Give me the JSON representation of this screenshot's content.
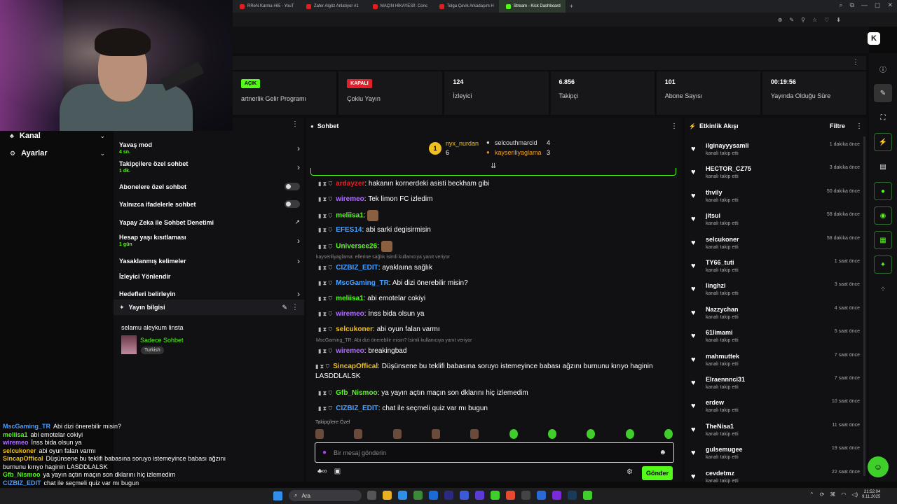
{
  "tabs": [
    {
      "label": "RReN Karma #65 - YouT",
      "active": false
    },
    {
      "label": "Zafer Algöz Anlatıyor #1",
      "active": false
    },
    {
      "label": "MAÇIN HİKAYESİ!: Conc",
      "active": false
    },
    {
      "label": "Tolga Çevik Arkadaşım H",
      "active": false
    },
    {
      "label": "Stream - Kick Dashboard",
      "active": true
    }
  ],
  "new_tab": "+",
  "stats": [
    {
      "badge": "AÇIK",
      "label": "artnerlik Gelir Programı",
      "badge_color": "green"
    },
    {
      "badge": "KAPALI",
      "label": "Çoklu Yayın",
      "badge_color": "red"
    },
    {
      "value": "124",
      "label": "İzleyici"
    },
    {
      "value": "6.856",
      "label": "Takipçi"
    },
    {
      "value": "101",
      "label": "Abone Sayısı"
    },
    {
      "value": "00:19:56",
      "label": "Yayında Olduğu Süre"
    }
  ],
  "leftnav": {
    "channel": "Kanal",
    "settings": "Ayarlar"
  },
  "chat_settings": [
    {
      "title": "Yavaş mod",
      "sub": "4 sn.",
      "control": "chevron"
    },
    {
      "title": "Takipçilere özel sohbet",
      "sub": "1 dk.",
      "control": "chevron"
    },
    {
      "title": "Abonelere özel sohbet",
      "sub": "",
      "control": "toggle"
    },
    {
      "title": "Yalnızca ifadelerle sohbet",
      "sub": "",
      "control": "toggle"
    },
    {
      "title": "Yapay Zeka ile Sohbet Denetimi",
      "sub": "",
      "control": "external"
    },
    {
      "title": "Hesap yaşı kısıtlaması",
      "sub": "1 gün",
      "control": "chevron"
    },
    {
      "title": "Yasaklanmış kelimeler",
      "sub": "",
      "control": "chevron"
    },
    {
      "title": "İzleyici Yönlendir",
      "sub": "",
      "control": "none"
    },
    {
      "title": "Hedefleri belirleyin",
      "sub": "",
      "control": "chevron"
    }
  ],
  "stream_info": {
    "header": "Yayın bilgisi",
    "title": "selamu aleykum linsta",
    "category": "Sadece Sohbet",
    "tag": "Turkish"
  },
  "chat": {
    "header": "Sohbet",
    "podium": {
      "first_name": "nyx_nurdan",
      "first_count": "6",
      "second_name": "selcouthmarcid",
      "second_count": "4",
      "third_name": "kayseriliyaglama",
      "third_count": "3"
    },
    "messages": [
      {
        "user": "ardayzer",
        "color": "#e0202a",
        "text": "hakanın kornerdeki asisti beckham gibi",
        "reply": ""
      },
      {
        "user": "wiremeo",
        "color": "#b070ff",
        "text": "Tek limon FC izledim",
        "reply": ""
      },
      {
        "user": "meliisa1",
        "color": "#53fc18",
        "text": "",
        "reply": "",
        "emote": true
      },
      {
        "user": "EFES14",
        "color": "#4aa0ff",
        "text": "abi sarki degisirmisin",
        "reply": ""
      },
      {
        "user": "Universee26",
        "color": "#53fc18",
        "text": "",
        "reply": "",
        "emote": true
      },
      {
        "user": "CIZBIZ_EDIT",
        "color": "#4aa0ff",
        "text": "ayaklaına sağlık",
        "reply": "kayseriliyaglama: ellerine sağlık isimli kullanıcıya yanıt veriyor"
      },
      {
        "user": "MscGaming_TR",
        "color": "#4aa0ff",
        "text": "Abi dizi önerebilir misin?",
        "reply": ""
      },
      {
        "user": "meliisa1",
        "color": "#53fc18",
        "text": "abi emotelar cokiyi",
        "reply": ""
      },
      {
        "user": "wiremeo",
        "color": "#b070ff",
        "text": "İnss bida olsun ya",
        "reply": ""
      },
      {
        "user": "selcukoner",
        "color": "#f0c020",
        "text": "abi oyun falan varmı",
        "reply": ""
      },
      {
        "user": "wiremeo",
        "color": "#b070ff",
        "text": "breakingbad",
        "reply": "MscGaming_TR: Abi dizi önerebilir misin? İsimli kullanıcıya yanıt veriyor"
      },
      {
        "user": "SincapOffical",
        "color": "#f0c020",
        "text": "Düşünsene bu teklifi babasına soruyo istemeyince babası ağzını burnunu kırıyo haginin LASDDLALSK",
        "reply": ""
      },
      {
        "user": "Gfb_Nismoo",
        "color": "#53fc18",
        "text": "ya yayın açtın maçın son dklarını hiç izlemedim",
        "reply": ""
      },
      {
        "user": "CIZBIZ_EDIT",
        "color": "#4aa0ff",
        "text": "chat ile seçmeli quiz var mı bugun",
        "reply": ""
      }
    ],
    "follow_only": "Takipçilere Özel",
    "input_placeholder": "Bir mesaj gönderin",
    "send": "Gönder"
  },
  "feed": {
    "header": "Etkinlik Akışı",
    "filter": "Filtre",
    "items": [
      {
        "name": "ilginayyysamli",
        "action": "kanalı takip etti",
        "time": "1 dakika önce"
      },
      {
        "name": "HECTOR_CZ75",
        "action": "kanalı takip etti",
        "time": "3 dakika önce"
      },
      {
        "name": "thvily",
        "action": "kanalı takip etti",
        "time": "50 dakika önce"
      },
      {
        "name": "jitsui",
        "action": "kanalı takip etti",
        "time": "58 dakika önce"
      },
      {
        "name": "selcukoner",
        "action": "kanalı takip etti",
        "time": "58 dakika önce"
      },
      {
        "name": "TY66_tuti",
        "action": "kanalı takip etti",
        "time": "1 saat önce"
      },
      {
        "name": "linghzi",
        "action": "kanalı takip etti",
        "time": "3 saat önce"
      },
      {
        "name": "Nazzychan",
        "action": "kanalı takip etti",
        "time": "4 saat önce"
      },
      {
        "name": "61limami",
        "action": "kanalı takip etti",
        "time": "5 saat önce"
      },
      {
        "name": "mahmuttek",
        "action": "kanalı takip etti",
        "time": "7 saat önce"
      },
      {
        "name": "Elraennnci31",
        "action": "kanalı takip etti",
        "time": "7 saat önce"
      },
      {
        "name": "erdew",
        "action": "kanalı takip etti",
        "time": "10 saat önce"
      },
      {
        "name": "TheNisa1",
        "action": "kanalı takip etti",
        "time": "11 saat önce"
      },
      {
        "name": "gulsemugee",
        "action": "kanalı takip etti",
        "time": "19 saat önce"
      },
      {
        "name": "cevdetmz",
        "action": "kanalı takip etti",
        "time": "22 saat önce"
      }
    ]
  },
  "overlay_chat": [
    {
      "user": "MscGaming_TR",
      "color": "#4aa0ff",
      "text": "Abi dizi önerebilir misin?"
    },
    {
      "user": "meliisa1",
      "color": "#53fc18",
      "text": "abi emotelar cokiyi"
    },
    {
      "user": "wiremeo",
      "color": "#b070ff",
      "text": "İnss bida olsun ya"
    },
    {
      "user": "selcukoner",
      "color": "#f0c020",
      "text": "abi oyun falan varmı"
    },
    {
      "user": "SincapOffical",
      "color": "#f0c020",
      "text": "Düşünsene bu teklifi babasına soruyo istemeyince babası ağzını burnunu kırıyo haginin LASDDLALSK"
    },
    {
      "user": "Gfb_Nismoo",
      "color": "#53fc18",
      "text": "ya yayın açtın maçın son dklarını hiç izlemedim"
    },
    {
      "user": "CIZBIZ_EDIT",
      "color": "#4aa0ff",
      "text": "chat ile seçmeli quiz var mı bugun"
    }
  ],
  "taskbar": {
    "search": "Ara",
    "time": "21:52:04",
    "date": "9.11.2025"
  },
  "colors": {
    "accent": "#53fc18",
    "live_red": "#e0202a",
    "bg": "#0b0b0c",
    "panel": "#111113"
  }
}
